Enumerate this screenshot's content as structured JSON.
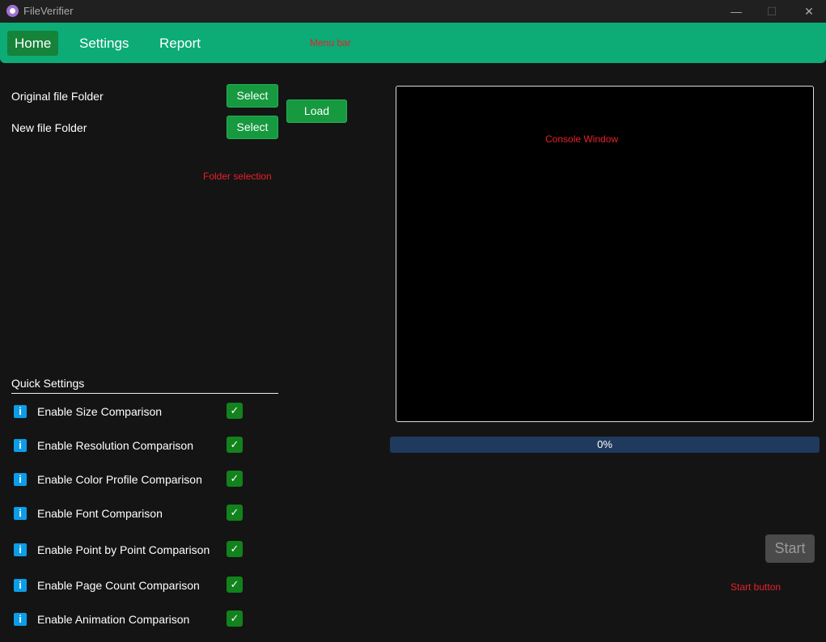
{
  "window": {
    "title": "FileVerifier",
    "minimize": "—",
    "maximize": "☐",
    "close": "✕"
  },
  "menu": {
    "items": [
      "Home",
      "Settings",
      "Report"
    ],
    "annotation": "Menu bar"
  },
  "folders": {
    "original_label": "Original file Folder",
    "new_label": "New file Folder",
    "select_label": "Select",
    "load_label": "Load",
    "annotation": "Folder selection"
  },
  "console": {
    "annotation": "Console Window"
  },
  "progress": {
    "value": 0,
    "text": "0%"
  },
  "start": {
    "label": "Start",
    "annotation": "Start button"
  },
  "quick_settings": {
    "title": "Quick Settings",
    "items": [
      {
        "label": "Enable Size Comparison",
        "checked": true
      },
      {
        "label": "Enable Resolution Comparison",
        "checked": true
      },
      {
        "label": "Enable Color Profile Comparison",
        "checked": true
      },
      {
        "label": "Enable Font Comparison",
        "checked": true
      },
      {
        "label": "Enable Point by Point Comparison",
        "checked": true
      },
      {
        "label": "Enable Page Count Comparison",
        "checked": true
      },
      {
        "label": "Enable Animation Comparison",
        "checked": true
      }
    ],
    "info_glyph": "i",
    "check_glyph": "✓"
  }
}
